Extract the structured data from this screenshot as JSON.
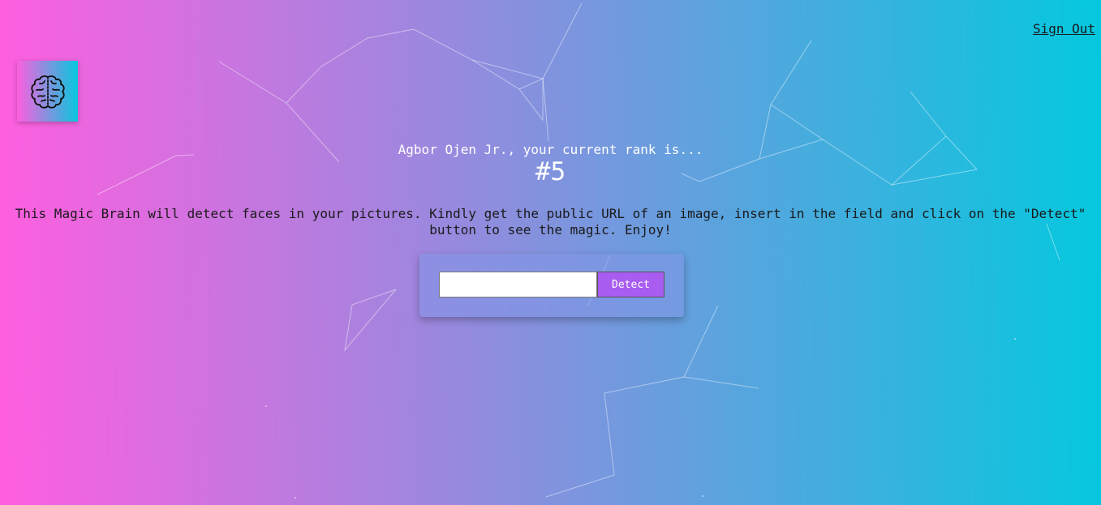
{
  "nav": {
    "sign_out_label": "Sign Out"
  },
  "logo": {
    "icon": "brain-icon"
  },
  "rank": {
    "message": "Agbor Ojen Jr., your current rank is...",
    "value": "#5"
  },
  "description": {
    "text": "This Magic Brain will detect faces in your pictures. Kindly get the public URL of an image, insert in the field and click on the \"Detect\" button to see the magic. Enjoy!"
  },
  "form": {
    "input_value": "",
    "input_placeholder": "",
    "button_label": "Detect"
  },
  "colors": {
    "gradient_start": "#ff5edf",
    "gradient_end": "#04c8de",
    "button": "#a85cf0"
  }
}
